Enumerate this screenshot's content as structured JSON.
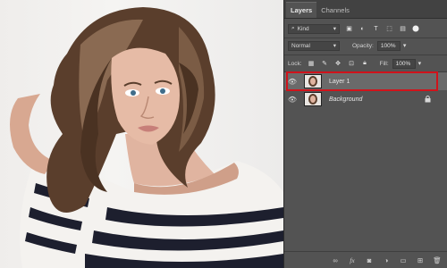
{
  "panel": {
    "tabs": [
      {
        "label": "Layers",
        "active": true
      },
      {
        "label": "Channels",
        "active": false
      }
    ],
    "filter": {
      "selected": "Kind"
    },
    "blend_mode": "Normal",
    "opacity": {
      "label": "Opacity:",
      "value": "100%"
    },
    "lock": {
      "label": "Lock:"
    },
    "fill": {
      "label": "Fill:",
      "value": "100%"
    },
    "layers": [
      {
        "name": "Layer 1",
        "visible": true,
        "selected": true,
        "locked": false
      },
      {
        "name": "Background",
        "visible": true,
        "selected": false,
        "locked": true
      }
    ],
    "bottom_icons": [
      "link-icon",
      "fx-icon",
      "mask-icon",
      "adjustment-icon",
      "group-icon",
      "new-layer-icon",
      "trash-icon"
    ]
  },
  "colors": {
    "panel_bg": "#535353",
    "selection_outline": "#d0131b",
    "selected_row": "#6a6a6a"
  }
}
